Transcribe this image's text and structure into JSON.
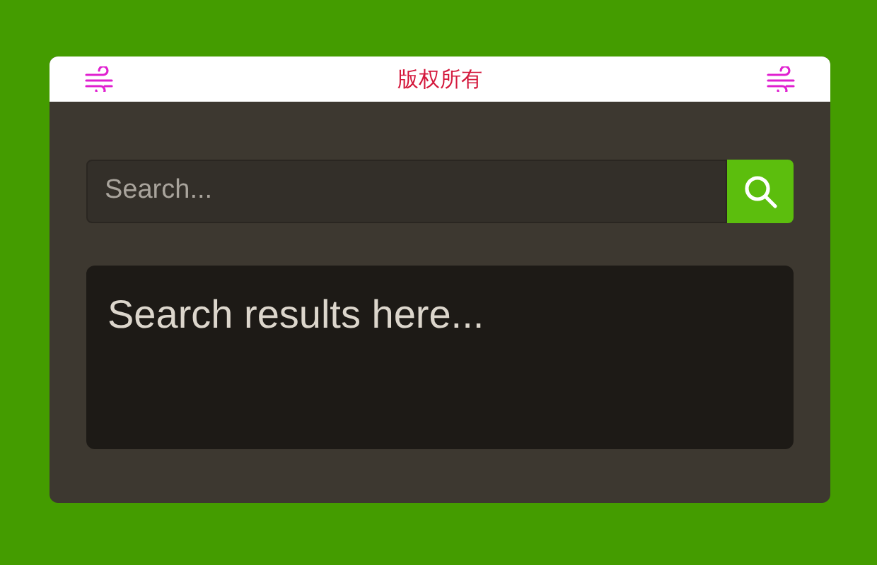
{
  "header": {
    "title": "版权所有"
  },
  "search": {
    "placeholder": "Search..."
  },
  "results": {
    "text": "Search results here..."
  }
}
